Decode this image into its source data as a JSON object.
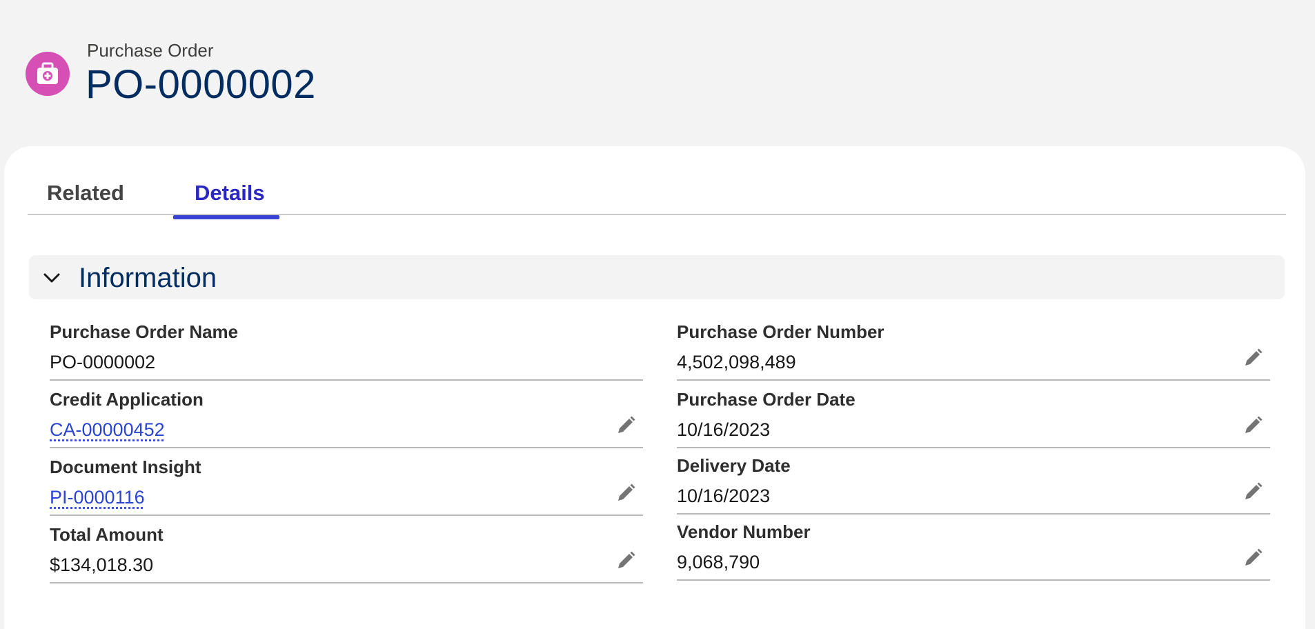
{
  "header": {
    "record_type": "Purchase Order",
    "title": "PO-0000002",
    "icon": "medical-kit-icon",
    "icon_color": "#d64fb4"
  },
  "tabs": [
    {
      "label": "Related",
      "active": false
    },
    {
      "label": "Details",
      "active": true
    }
  ],
  "accent_color": "#3b42d6",
  "section": {
    "title": "Information",
    "expanded": true
  },
  "fields_left": [
    {
      "label": "Purchase Order Name",
      "value": "PO-0000002",
      "link": false,
      "editable": false
    },
    {
      "label": "Credit Application",
      "value": "CA-00000452",
      "link": true,
      "editable": true
    },
    {
      "label": "Document Insight",
      "value": "PI-0000116",
      "link": true,
      "editable": true
    },
    {
      "label": "Total Amount",
      "value": "$134,018.30",
      "link": false,
      "editable": true
    }
  ],
  "fields_right": [
    {
      "label": "Purchase Order Number",
      "value": "4,502,098,489",
      "link": false,
      "editable": true
    },
    {
      "label": "Purchase Order Date",
      "value": "10/16/2023",
      "link": false,
      "editable": true
    },
    {
      "label": "Delivery Date",
      "value": "10/16/2023",
      "link": false,
      "editable": true
    },
    {
      "label": "Vendor Number",
      "value": "9,068,790",
      "link": false,
      "editable": true
    }
  ]
}
